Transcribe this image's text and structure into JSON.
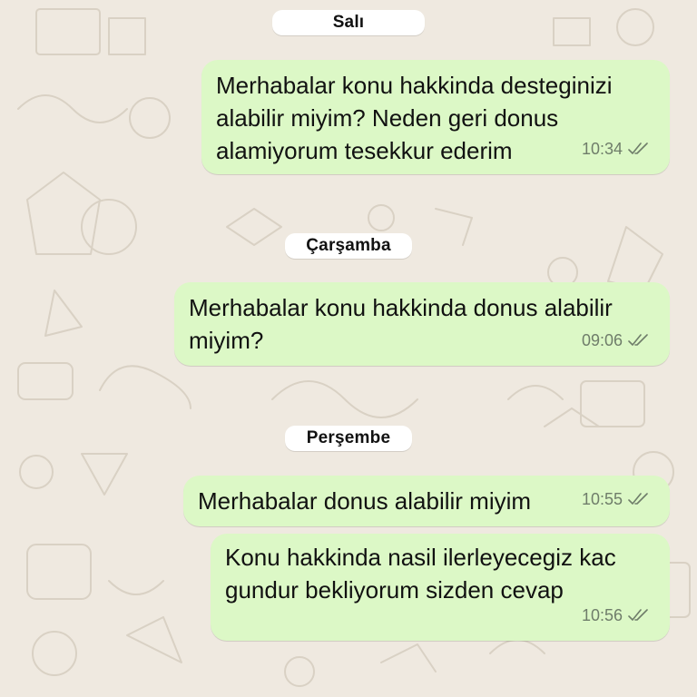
{
  "colors": {
    "background": "#efe9e0",
    "outgoing_bubble": "#dcf8c6",
    "date_pill": "#ffffff",
    "meta_text": "#6f7d6a"
  },
  "days": [
    {
      "date_label": "Salı",
      "messages": [
        {
          "text": "Merhabalar konu hakkinda desteginizi alabilir miyim? Neden geri donus alamiyorum tesekkur ederim",
          "time": "10:34",
          "status_icon": "double-check-icon"
        }
      ]
    },
    {
      "date_label": "Çarşamba",
      "messages": [
        {
          "text": "Merhabalar konu hakkinda donus alabilir miyim?",
          "time": "09:06",
          "status_icon": "double-check-icon"
        }
      ]
    },
    {
      "date_label": "Perşembe",
      "messages": [
        {
          "text": "Merhabalar donus alabilir miyim",
          "time": "10:55",
          "status_icon": "double-check-icon"
        },
        {
          "text": "Konu hakkinda nasil ilerleyecegiz kac gundur bekliyorum sizden cevap",
          "time": "10:56",
          "status_icon": "double-check-icon"
        }
      ]
    }
  ]
}
